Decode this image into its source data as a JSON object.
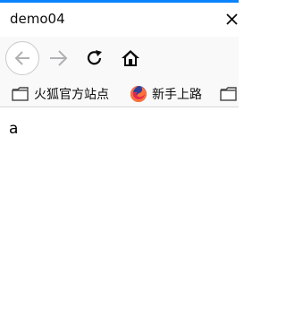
{
  "window": {
    "accent_color": "#0a84ff"
  },
  "tab": {
    "title": "demo04",
    "close_icon": "close-icon"
  },
  "navbar": {
    "back_icon": "arrow-left-icon",
    "forward_icon": "arrow-right-icon",
    "reload_icon": "reload-icon",
    "home_icon": "home-icon"
  },
  "bookmarks": {
    "items": [
      {
        "label": "火狐官方站点",
        "icon": "folder-icon"
      },
      {
        "label": "新手上路",
        "icon": "firefox-icon"
      },
      {
        "label": "",
        "icon": "folder-icon"
      }
    ]
  },
  "page": {
    "text": "a"
  }
}
